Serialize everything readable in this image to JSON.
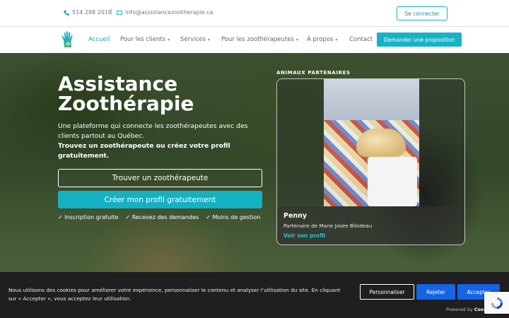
{
  "topbar": {
    "phone": "514 298 2018",
    "separator": "|",
    "email": "info@assistancezootherapie.ca",
    "login_button": "Se connecter"
  },
  "nav": {
    "items": [
      {
        "label": "Accueil",
        "active": true
      },
      {
        "label": "Pour les clients",
        "caret": "▾"
      },
      {
        "label": "Services",
        "caret": "▾"
      },
      {
        "label": "Pour les zoothérapeutes",
        "caret": "▾"
      },
      {
        "label": "À propos",
        "caret": "▾"
      },
      {
        "label": "Contact"
      }
    ],
    "cta_button": "Demander une proposition"
  },
  "hero": {
    "title": "Assistance Zoothérapie",
    "description": "Une plateforme qui connecte les zoothérapeutes avec des clients partout au Québec.",
    "description_bold": "Trouvez un zoothérapeute ou créez votre profil gratuitement.",
    "find_button": "Trouver un zoothérapeute",
    "create_button": "Créer mon profil gratuitement",
    "perks": [
      "✓ Inscription gratuite",
      "✓ Recevez des demandes",
      "✓ Moins de gestion"
    ]
  },
  "partners": {
    "section_label": "ANIMAUX PARTENAIRES",
    "card": {
      "name": "Penny",
      "subtitle": "Partenaire de Marie Josée Bilodeau",
      "link": "Voir son profil"
    }
  },
  "cookie": {
    "text": "Nous utilisons des cookies pour améliorer votre expérience, personnaliser le contenu et analyser l’utilisation du site. En cliquant sur « Accepter », vous acceptez leur utilisation.",
    "customize_button": "Personnaliser",
    "reject_button": "Rejeter",
    "accept_button": "Accepter",
    "powered_prefix": "Powered by",
    "powered_brand": "Coo"
  },
  "colors": {
    "accent": "#14b1c3",
    "cookie_button": "#1663e6",
    "cookie_bg": "#1f1f1f"
  }
}
